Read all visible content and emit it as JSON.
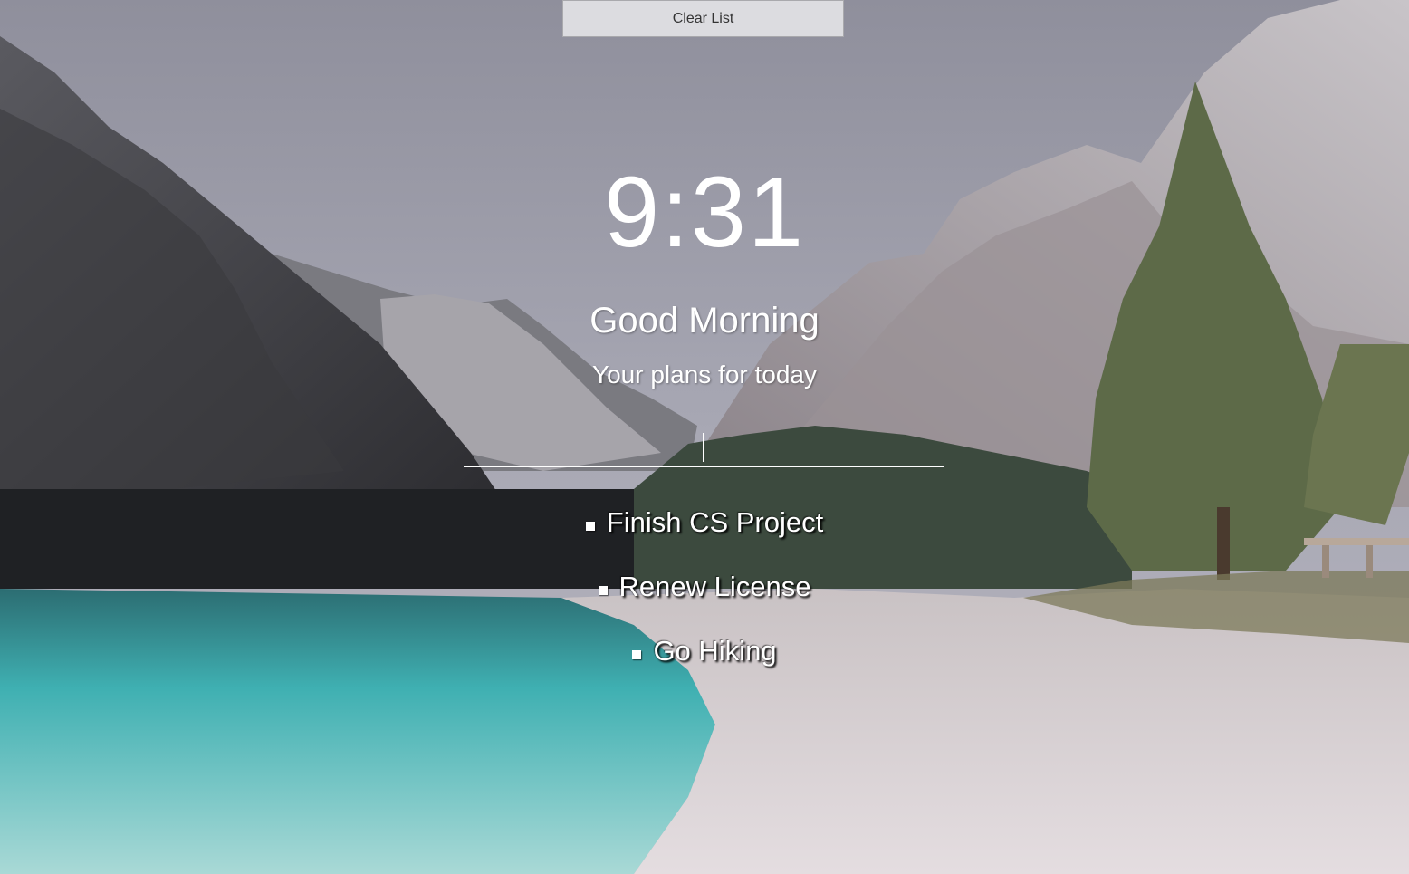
{
  "toolbar": {
    "clear_label": "Clear List"
  },
  "clock": {
    "time": "9:31"
  },
  "greeting": {
    "text": "Good Morning"
  },
  "plans": {
    "label": "Your plans for today"
  },
  "task_input": {
    "value": "",
    "placeholder": ""
  },
  "todos": [
    {
      "text": "Finish CS Project"
    },
    {
      "text": "Renew License"
    },
    {
      "text": "Go Hiking"
    }
  ],
  "colors": {
    "sky": "#9a9aa6",
    "text": "#ffffff",
    "button_bg": "#dcdce0",
    "lake": "#3fb0b2",
    "beach": "#d9d2d4"
  }
}
